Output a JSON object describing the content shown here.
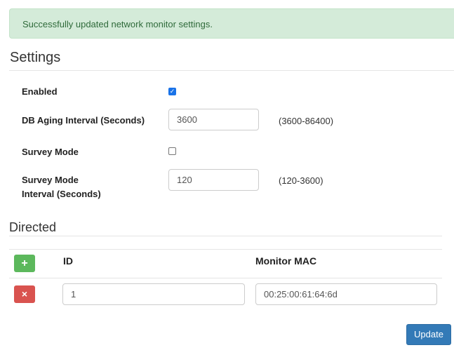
{
  "alert": {
    "message": "Successfully updated network monitor settings."
  },
  "settings": {
    "title": "Settings",
    "enabled_label": "Enabled",
    "enabled": true,
    "aging_label": "DB Aging Interval (Seconds)",
    "aging_value": "3600",
    "aging_hint": "(3600-86400)",
    "survey_label": "Survey Mode",
    "survey": false,
    "survey_interval_label_1": "Survey Mode",
    "survey_interval_label_2": "Interval (Seconds)",
    "survey_interval_value": "120",
    "survey_interval_hint": "(120-3600)"
  },
  "directed": {
    "title": "Directed",
    "add_icon": "+",
    "remove_icon": "×",
    "columns": [
      "ID",
      "Monitor MAC"
    ],
    "rows": [
      {
        "id": "1",
        "mac": "00:25:00:61:64:6d"
      }
    ]
  },
  "update_label": "Update"
}
